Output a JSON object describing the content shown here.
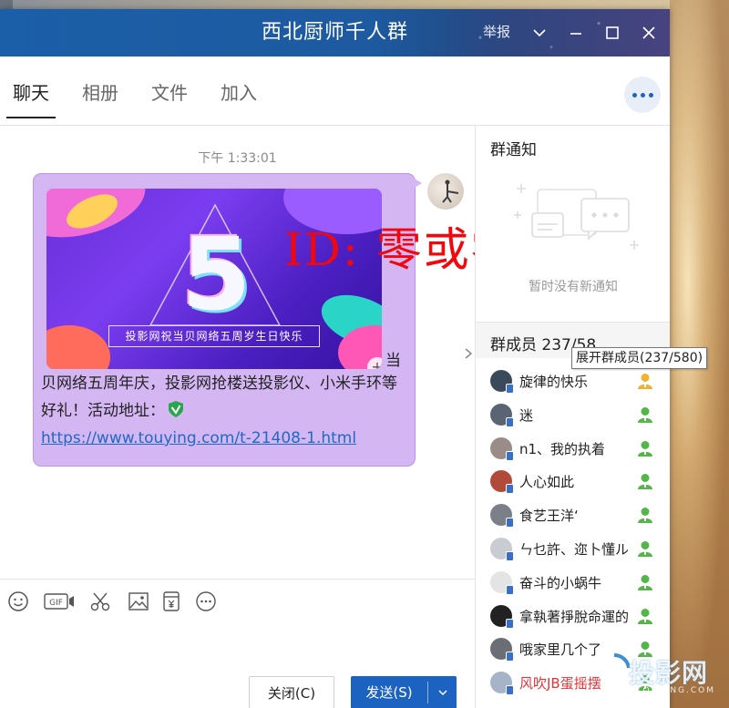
{
  "window": {
    "title": "西北厨师千人群",
    "report_label": "举报"
  },
  "tabs": [
    {
      "label": "聊天",
      "active": true
    },
    {
      "label": "相册",
      "active": false
    },
    {
      "label": "文件",
      "active": false
    },
    {
      "label": "加入",
      "active": false
    }
  ],
  "chat": {
    "time": "下午 1:33:01",
    "banner_caption": "投影网祝当贝网络五周岁生日快乐",
    "banner_number": "5",
    "message_prefix": "当",
    "message_text": "贝网络五周年庆，投影网抢楼送投影仪、小米手环等好礼！活动地址：",
    "message_link": "https://www.touying.com/t-21408-1.html",
    "overlay_id": "ID: 零或零"
  },
  "toolbar": {
    "gif_label": "GIF",
    "close_label": "关闭(C)",
    "send_label": "发送(S)"
  },
  "side": {
    "notice_title": "群通知",
    "notice_empty": "暂时没有新通知",
    "members_title": "群成员 237/58",
    "members_tooltip": "展开群成员(237/580)",
    "members": [
      {
        "name": "旋律的快乐",
        "role": "owner",
        "avatar": "#3b4a5a"
      },
      {
        "name": "迷",
        "role": "member",
        "avatar": "#5a6472"
      },
      {
        "name": "n1、我的执着",
        "role": "member",
        "avatar": "#9a8c86"
      },
      {
        "name": "人心如此",
        "role": "member",
        "avatar": "#b24a3a"
      },
      {
        "name": "食艺王洋‘",
        "role": "member",
        "avatar": "#7a7f88"
      },
      {
        "name": "ㄣ乜許、迩卜懂ル",
        "role": "member",
        "avatar": "#c9ccd3"
      },
      {
        "name": "奋斗的小蜗牛",
        "role": "member",
        "avatar": "#e4e4e4"
      },
      {
        "name": "拿執著掙脫命運的",
        "role": "member",
        "avatar": "#222222"
      },
      {
        "name": "哦家里几个了",
        "role": "member",
        "avatar": "#6b6e74"
      },
      {
        "name": "风吹JB蛋摇摆",
        "role": "member",
        "avatar": "#a7b4c8",
        "red": true
      }
    ]
  },
  "watermark": {
    "text": "投影网",
    "sub": "TOUYING.COM"
  },
  "colors": {
    "title_bar": "#1d5aa0",
    "bubble": "#d4b6f3",
    "send_button": "#1b62c1",
    "link": "#2169c4",
    "role_owner": "#f0b232",
    "role_member": "#55b54a"
  }
}
